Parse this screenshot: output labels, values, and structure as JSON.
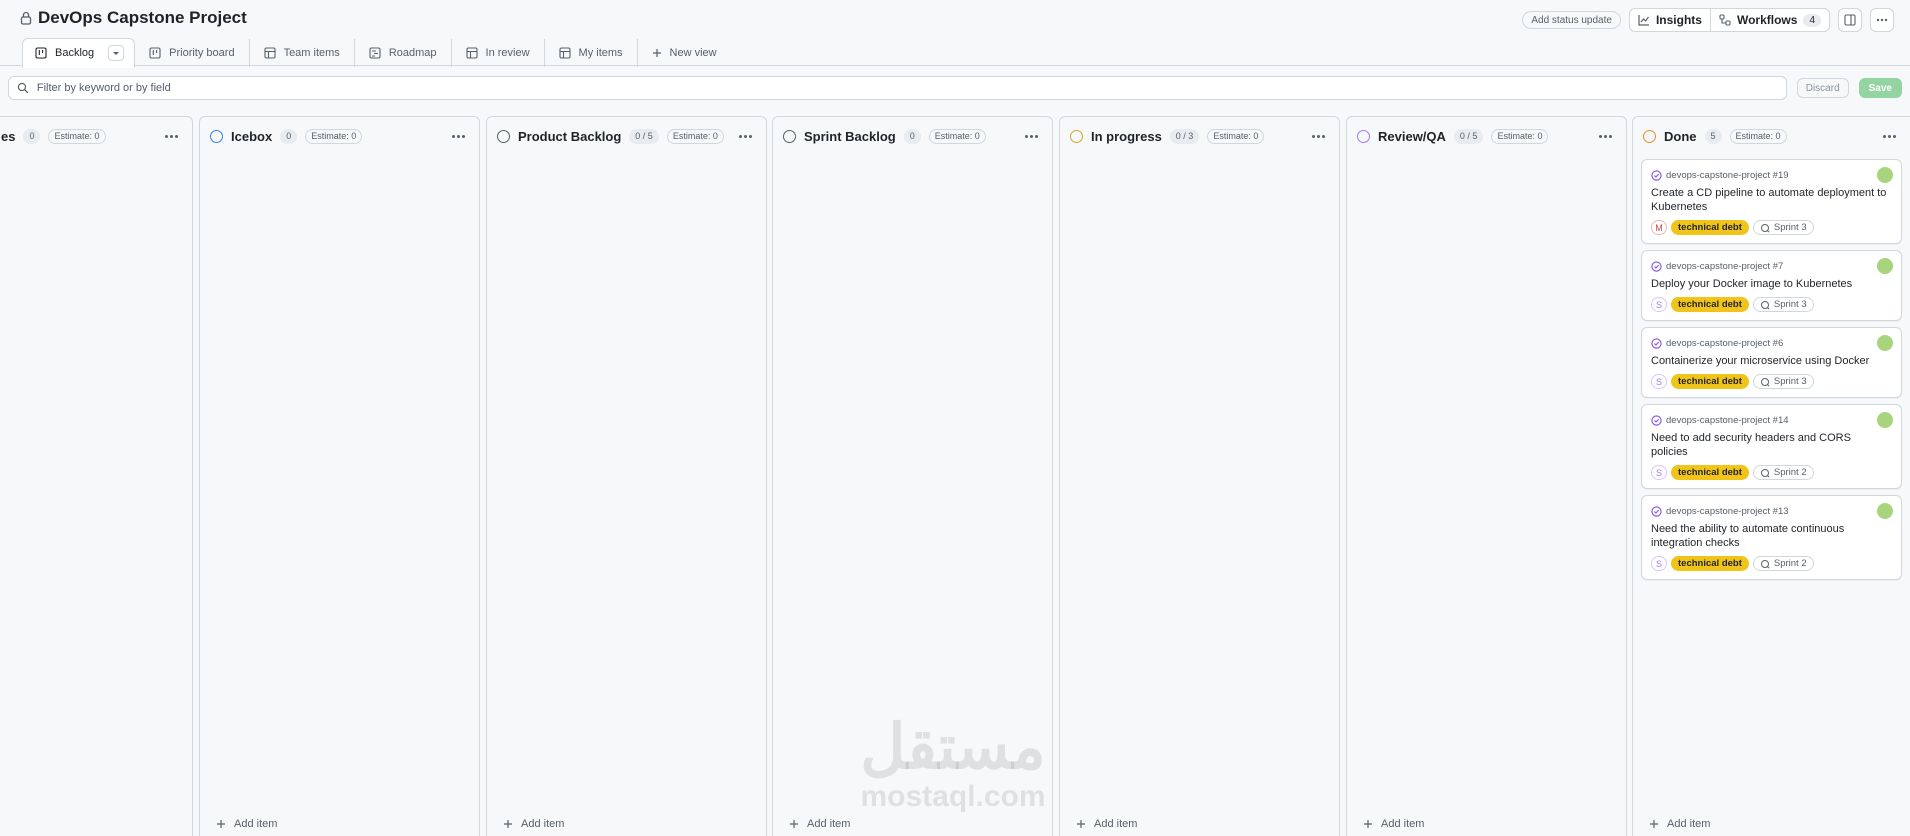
{
  "project": {
    "title": "DevOps Capstone Project"
  },
  "header": {
    "status_update": "Add status update",
    "insights": "Insights",
    "workflows": "Workflows",
    "workflows_count": "4"
  },
  "tabs": [
    {
      "label": "Backlog",
      "icon": "board-icon"
    },
    {
      "label": "Priority board",
      "icon": "board-icon"
    },
    {
      "label": "Team items",
      "icon": "table-icon"
    },
    {
      "label": "Roadmap",
      "icon": "roadmap-icon"
    },
    {
      "label": "In review",
      "icon": "table-icon"
    },
    {
      "label": "My items",
      "icon": "table-icon"
    },
    {
      "label": "New view",
      "icon": "plus-icon"
    }
  ],
  "filter": {
    "placeholder": "Filter by keyword or by field",
    "discard": "Discard",
    "save": "Save"
  },
  "columns": [
    {
      "name": "es",
      "count": "0",
      "estimate": "Estimate: 0",
      "color": "#57606a"
    },
    {
      "name": "Icebox",
      "count": "0",
      "estimate": "Estimate: 0",
      "color": "#2f80ed"
    },
    {
      "name": "Product Backlog",
      "count": "0 / 5",
      "estimate": "Estimate: 0",
      "color": "#57606a"
    },
    {
      "name": "Sprint Backlog",
      "count": "0",
      "estimate": "Estimate: 0",
      "color": "#57606a"
    },
    {
      "name": "In progress",
      "count": "0 / 3",
      "estimate": "Estimate: 0",
      "color": "#d4a72c"
    },
    {
      "name": "Review/QA",
      "count": "0 / 5",
      "estimate": "Estimate: 0",
      "color": "#a475f9"
    },
    {
      "name": "Done",
      "count": "5",
      "estimate": "Estimate: 0",
      "color": "#e8912d"
    }
  ],
  "add_item": "Add item",
  "cards": [
    {
      "ref": "devops-capstone-project #19",
      "title": "Create a CD pipeline to automate deployment to Kubernetes",
      "size": "M",
      "label": "technical debt",
      "sprint": "Sprint 3"
    },
    {
      "ref": "devops-capstone-project #7",
      "title": "Deploy your Docker image to Kubernetes",
      "size": "S",
      "label": "technical debt",
      "sprint": "Sprint 3"
    },
    {
      "ref": "devops-capstone-project #6",
      "title": "Containerize your microservice using Docker",
      "size": "S",
      "label": "technical debt",
      "sprint": "Sprint 3"
    },
    {
      "ref": "devops-capstone-project #14",
      "title": "Need to add security headers and CORS policies",
      "size": "S",
      "label": "technical debt",
      "sprint": "Sprint 2"
    },
    {
      "ref": "devops-capstone-project #13",
      "title": "Need the ability to automate continuous integration checks",
      "size": "S",
      "label": "technical debt",
      "sprint": "Sprint 2"
    }
  ],
  "colors": {
    "label_bg": "#f0c419",
    "label_fg": "#1f2328",
    "closed_issue": "#8250df",
    "size_m": "#d1453b",
    "size_s": "#a475f9"
  },
  "watermark": {
    "arabic": "مستقل",
    "latin": "mostaql.com"
  }
}
